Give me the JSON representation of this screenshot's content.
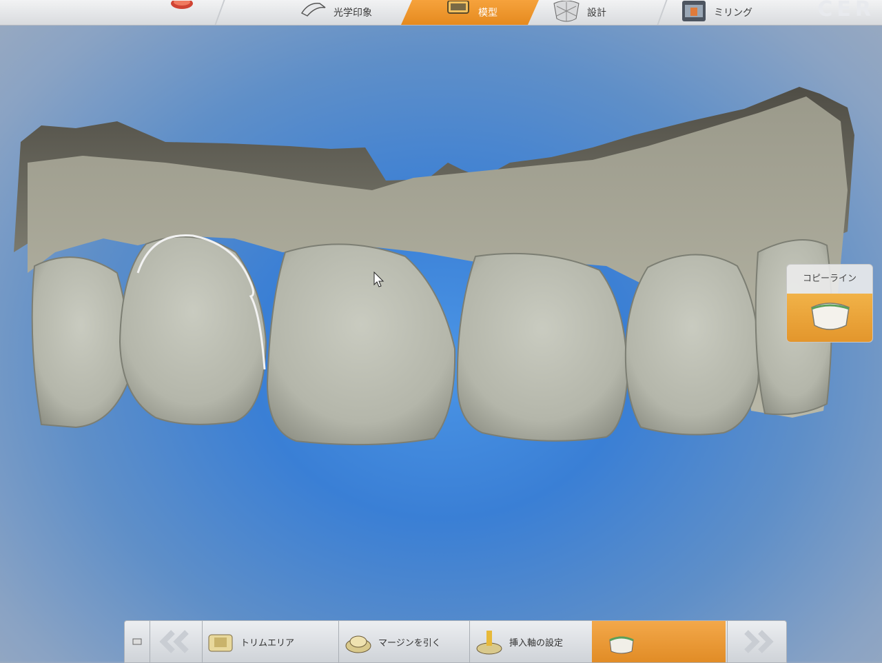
{
  "topbar": {
    "phases": [
      {
        "label": "",
        "icon": "admin-icon"
      },
      {
        "label": "光学印象",
        "icon": "camera-icon"
      },
      {
        "label": "模型",
        "icon": "model-icon",
        "active": true
      },
      {
        "label": "設計",
        "icon": "design-icon"
      },
      {
        "label": "ミリング",
        "icon": "milling-icon"
      }
    ],
    "brand": "CER"
  },
  "side_tool": {
    "label": "コピーライン",
    "icon": "copy-line-icon"
  },
  "stepbar": {
    "collapse_label": "",
    "back_icon": "double-chevron-left-icon",
    "steps": [
      {
        "label": "トリムエリア",
        "icon": "trim-area-icon"
      },
      {
        "label": "マージンを引く",
        "icon": "draw-margin-icon"
      },
      {
        "label": "挿入軸の設定",
        "icon": "insertion-axis-icon"
      },
      {
        "label": "",
        "icon": "copy-line-step-icon",
        "active": true
      }
    ],
    "next_icon": "double-chevron-right-icon"
  },
  "colors": {
    "accent": "#e58a1f",
    "viewport_blue": "#3a7fd5",
    "model_gray": "#b3b2a2"
  }
}
